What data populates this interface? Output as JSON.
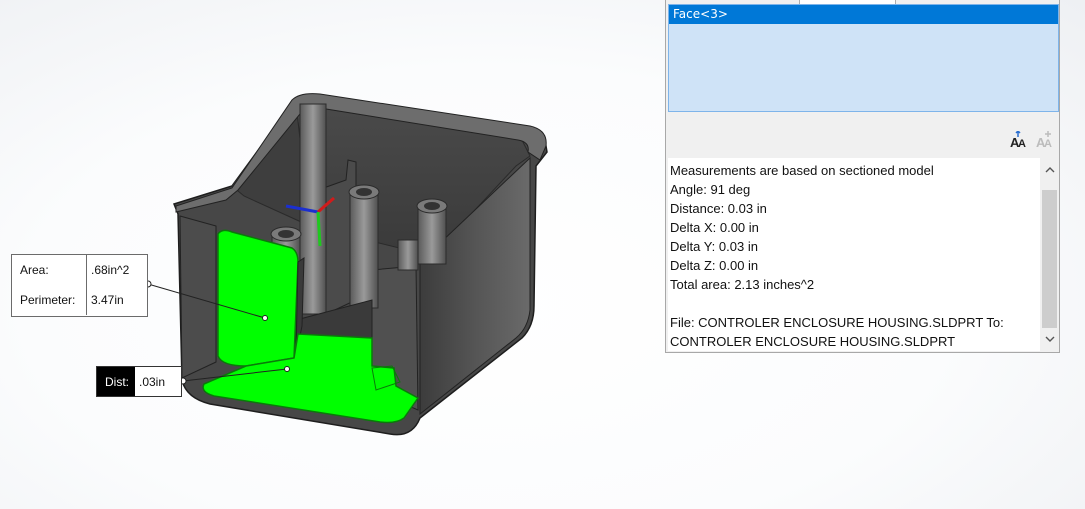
{
  "viewport": {
    "area_callout": {
      "area_label": "Area:",
      "area_value": ".68in^2",
      "perimeter_label": "Perimeter:",
      "perimeter_value": "3.47in"
    },
    "dist_callout": {
      "label": "Dist:",
      "value": ".03in"
    },
    "colors": {
      "selected_face": "#00ff00",
      "model_body": "#5a5a5a"
    }
  },
  "measure_panel": {
    "selection_list": [
      "Face<3>"
    ],
    "tool_icons": [
      "text-size-icon",
      "text-size-disabled-icon"
    ],
    "results": [
      "Measurements are based on sectioned model",
      "Angle: 91 deg",
      "Distance: 0.03 in",
      "Delta X: 0.00 in",
      "Delta Y: 0.03 in",
      "Delta Z: 0.00 in",
      "Total area: 2.13 inches^2",
      "",
      "File: CONTROLER ENCLOSURE HOUSING.SLDPRT To:",
      "CONTROLER ENCLOSURE HOUSING.SLDPRT"
    ],
    "colors": {
      "selection_highlight": "#0078d7",
      "list_background": "#cfe3f7"
    }
  }
}
